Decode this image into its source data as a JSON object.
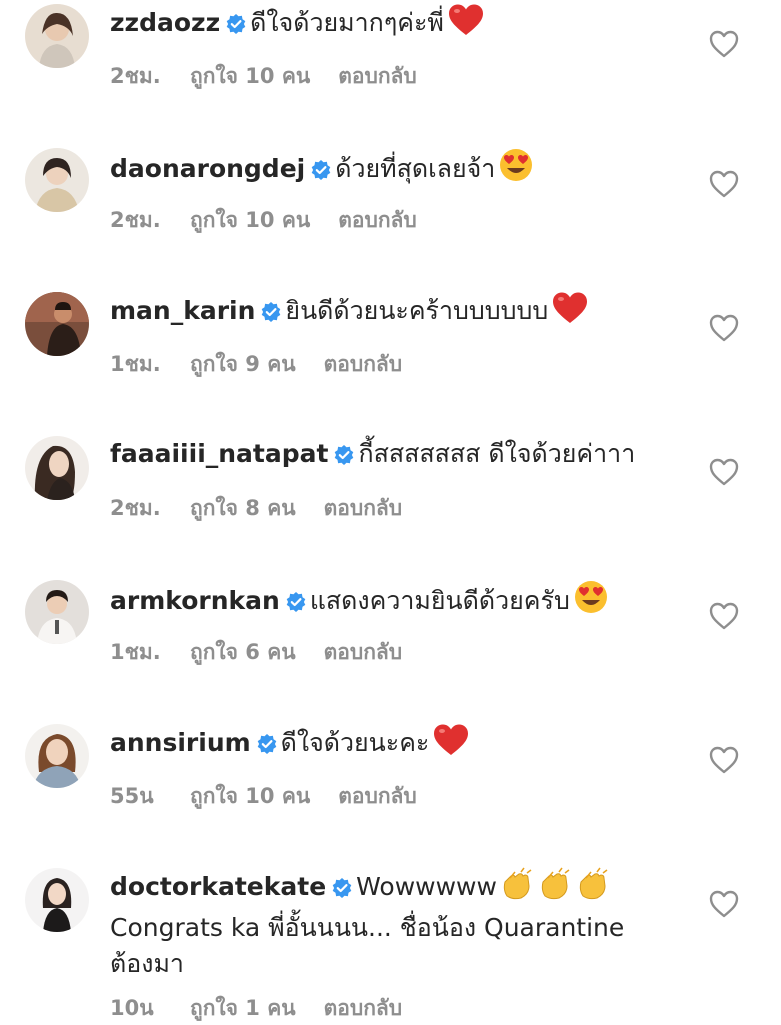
{
  "comments": [
    {
      "username": "zzdaozz",
      "text": "ดีใจด้วยมากๆค่ะพี่",
      "emoji": "heart-emoji",
      "time": "2ชม.",
      "likes": "ถูกใจ 10 คน",
      "reply": "ตอบกลับ",
      "avatar_color": "#cbb8a8"
    },
    {
      "username": "daonarongdej",
      "text": "ด้วยที่สุดเลยจ้า",
      "emoji": "heart-eyes-emoji",
      "time": "2ชม.",
      "likes": "ถูกใจ 10 คน",
      "reply": "ตอบกลับ",
      "avatar_color": "#c8b9a6"
    },
    {
      "username": "man_karin",
      "text": "ยินดีด้วยนะคร้าบบบบบบ",
      "emoji": "heart-emoji",
      "time": "1ชม.",
      "likes": "ถูกใจ 9 คน",
      "reply": "ตอบกลับ",
      "avatar_color": "#6e4a3a"
    },
    {
      "username": "faaaiiii_natapat",
      "text": "กี้สสสสสสส ดีใจด้วยค่าาา",
      "emoji": "",
      "time": "2ชม.",
      "likes": "ถูกใจ 8 คน",
      "reply": "ตอบกลับ",
      "avatar_color": "#5a463c"
    },
    {
      "username": "armkornkan",
      "text": "แสดงความยินดีด้วยครับ",
      "emoji": "heart-eyes-emoji",
      "time": "1ชม.",
      "likes": "ถูกใจ 6 คน",
      "reply": "ตอบกลับ",
      "avatar_color": "#d7d2cc"
    },
    {
      "username": "annsirium",
      "text": "ดีใจด้วยนะคะ",
      "emoji": "heart-emoji",
      "time": "55น",
      "likes": "ถูกใจ 10 คน",
      "reply": "ตอบกลับ",
      "avatar_color": "#9aa7b4"
    },
    {
      "username": "doctorkatekate",
      "text": "Wowwwww",
      "emoji": "clapping-hands-emoji",
      "text2": "Congrats ka พี่อั้นนนน... ชื่อน้อง Quarantine",
      "text3": "ต้องมา",
      "time": "10น",
      "likes": "ถูกใจ 1 คน",
      "reply": "ตอบกลับ",
      "avatar_color": "#e8e6e6"
    }
  ],
  "colors": {
    "verified": "#3897f0",
    "meta_text": "#8e8e8e",
    "username": "#262626",
    "heart_emoji": "#e0302f",
    "emoji_face": "#fbbf2e"
  }
}
